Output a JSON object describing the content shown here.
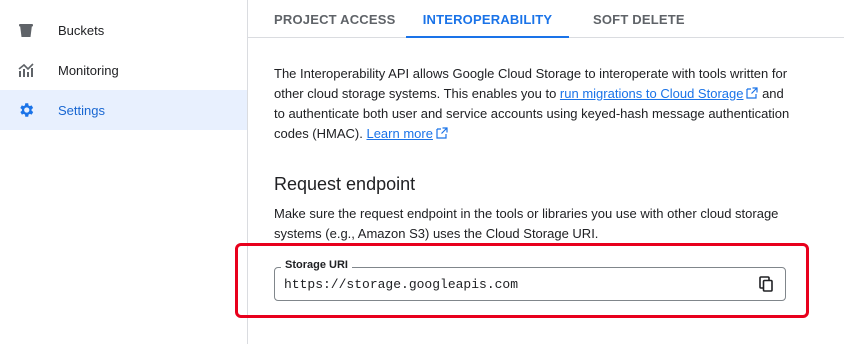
{
  "sidebar": {
    "items": [
      {
        "label": "Buckets",
        "icon": "bucket-icon"
      },
      {
        "label": "Monitoring",
        "icon": "chart-icon"
      },
      {
        "label": "Settings",
        "icon": "gear-icon",
        "active": true
      }
    ]
  },
  "tabs": [
    {
      "label": "PROJECT ACCESS"
    },
    {
      "label": "INTEROPERABILITY",
      "active": true
    },
    {
      "label": "SOFT DELETE"
    }
  ],
  "intro": {
    "text1": "The Interoperability API allows Google Cloud Storage to interoperate with tools written for other cloud storage systems. This enables you to ",
    "link1": "run migrations to Cloud Storage",
    "text2": " and to authenticate both user and service accounts using keyed-hash message authentication codes (HMAC). ",
    "link2": "Learn more"
  },
  "request_endpoint": {
    "heading": "Request endpoint",
    "description": "Make sure the request endpoint in the tools or libraries you use with other cloud storage systems (e.g., Amazon S3) uses the Cloud Storage URI.",
    "field_label": "Storage URI",
    "field_value": "https://storage.googleapis.com",
    "copy_icon": "copy-icon"
  },
  "colors": {
    "accent": "#1a73e8",
    "active_bg": "#e8f0fe",
    "highlight": "#e8001c"
  }
}
